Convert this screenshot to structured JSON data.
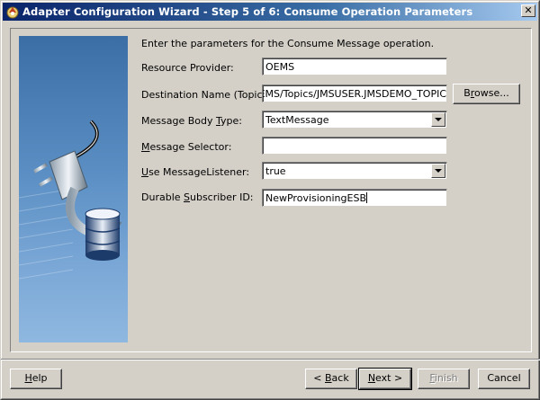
{
  "window": {
    "title": "Adapter Configuration Wizard - Step 5 of 6: Consume Operation Parameters",
    "close_glyph": "✕"
  },
  "intro": "Enter the parameters for the Consume Message operation.",
  "fields": {
    "resource_provider": {
      "label": "Resource Provider:",
      "value": "OEMS"
    },
    "destination_name": {
      "label": "Destination Name (Topic):",
      "value": "OEMS/Topics/JMSUSER.JMSDEMO_TOPIC",
      "browse_label": "Browse...",
      "browse_mnemonic": "r"
    },
    "message_body_type": {
      "label": "Message Body Type:",
      "label_pre": "Message Body ",
      "label_mn": "T",
      "label_post": "ype:",
      "value": "TextMessage"
    },
    "message_selector": {
      "label": "Message Selector:",
      "label_mn": "M",
      "label_post": "essage Selector:",
      "value": ""
    },
    "use_message_listener": {
      "label": "Use MessageListener:",
      "label_mn": "U",
      "label_post": "se MessageListener:",
      "value": "true"
    },
    "durable_subscriber_id": {
      "label": "Durable Subscriber ID:",
      "label_pre": "Durable ",
      "label_mn": "S",
      "label_post": "ubscriber ID:",
      "value": "NewProvisioningESB"
    }
  },
  "buttons": {
    "help": {
      "mn": "H",
      "rest": "elp"
    },
    "back": {
      "pre": "< ",
      "mn": "B",
      "rest": "ack"
    },
    "next": {
      "mn": "N",
      "rest": "ext >"
    },
    "finish": {
      "mn": "F",
      "rest": "inish"
    },
    "cancel": {
      "label": "Cancel"
    }
  },
  "colors": {
    "titlebar_start": "#0a246a",
    "titlebar_end": "#a6caf0",
    "dialog_bg": "#d4d0c8"
  },
  "icons": [
    "wizard-app-icon",
    "plug-cable-icon",
    "database-icon"
  ]
}
